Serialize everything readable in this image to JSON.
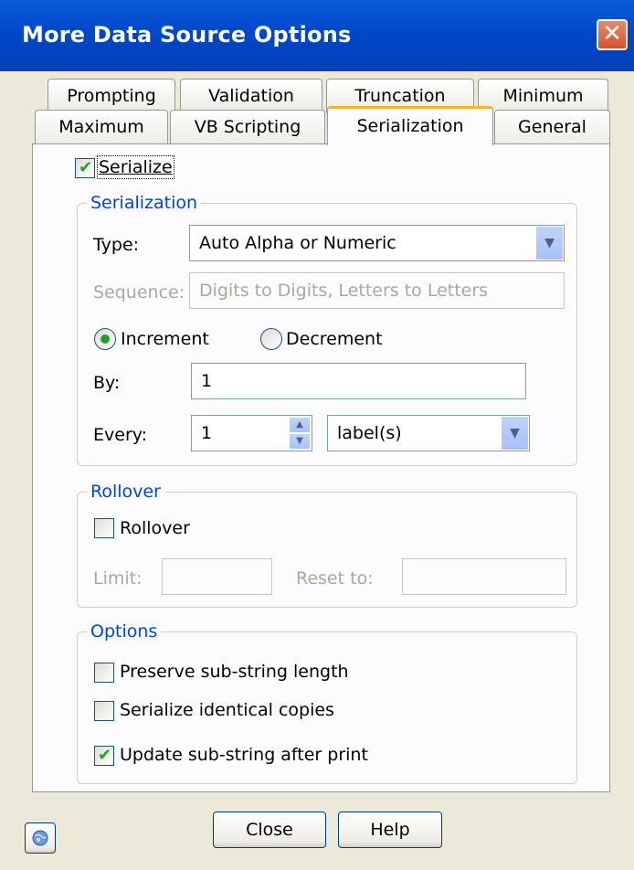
{
  "window": {
    "title": "More Data Source Options",
    "close_glyph": "✕"
  },
  "tabs_row1": [
    "Prompting",
    "Validation",
    "Truncation",
    "Minimum"
  ],
  "tabs_row2": [
    "Maximum",
    "VB Scripting",
    "Serialization",
    "General"
  ],
  "active_tab": "Serialization",
  "serialize_checkbox": {
    "label": "Serialize",
    "checked": true
  },
  "serialization_group": {
    "legend": "Serialization",
    "type_label": "Type:",
    "type_value": "Auto Alpha or Numeric",
    "sequence_label": "Sequence:",
    "sequence_value": "Digits to Digits, Letters to Letters",
    "increment_label": "Increment",
    "decrement_label": "Decrement",
    "selected_direction": "Increment",
    "by_label": "By:",
    "by_value": "1",
    "every_label": "Every:",
    "every_value": "1",
    "every_unit": "label(s)"
  },
  "rollover_group": {
    "legend": "Rollover",
    "checkbox_label": "Rollover",
    "checked": false,
    "limit_label": "Limit:",
    "limit_value": "",
    "reset_label": "Reset to:",
    "reset_value": ""
  },
  "options_group": {
    "legend": "Options",
    "items": [
      {
        "label": "Preserve sub-string length",
        "checked": false
      },
      {
        "label": "Serialize identical copies",
        "checked": false
      },
      {
        "label": "Update sub-string after print",
        "checked": true
      }
    ]
  },
  "buttons": {
    "close": "Close",
    "help": "Help"
  },
  "icons": {
    "help_icon": "globe-icon",
    "check": "✔"
  },
  "colors": {
    "titlebar": "#0046c8",
    "accent": "#0046d5",
    "check": "#21a121"
  }
}
